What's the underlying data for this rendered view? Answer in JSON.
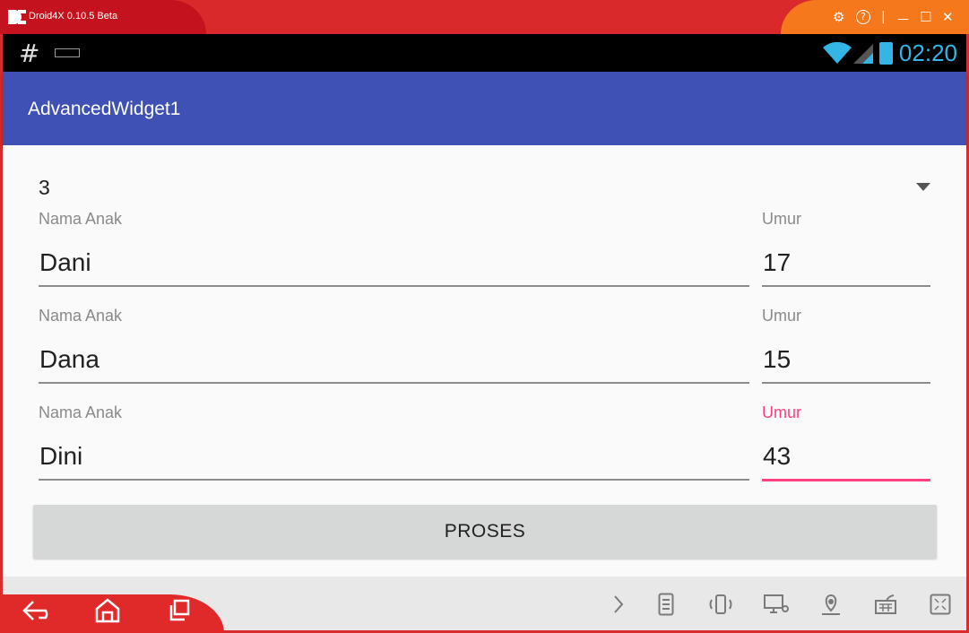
{
  "window": {
    "title": "Droid4X 0.10.5 Beta",
    "controls": {
      "settings": "⚙",
      "help": "?",
      "minimize": "—",
      "maximize": "☐",
      "close": "✕"
    }
  },
  "statusbar": {
    "left_icon": "#",
    "time": "02:20"
  },
  "appbar": {
    "title": "AdvancedWidget1"
  },
  "spinner": {
    "selected_value": "3"
  },
  "rows": [
    {
      "name_label": "Nama Anak",
      "name_value": "Dani",
      "age_label": "Umur",
      "age_value": "17"
    },
    {
      "name_label": "Nama Anak",
      "name_value": "Dana",
      "age_label": "Umur",
      "age_value": "15"
    },
    {
      "name_label": "Nama Anak",
      "name_value": "Dini",
      "age_label": "Umur",
      "age_value": "43"
    }
  ],
  "button": {
    "label": "PROSES"
  },
  "colors": {
    "primary": "#3f51b5",
    "accent": "#ff4081",
    "status_clock": "#33b5e5",
    "emulator_red": "#d9292b",
    "emulator_orange": "#f6781c"
  },
  "icons": {
    "nav": [
      "back-icon",
      "home-icon",
      "recents-icon"
    ],
    "tools": [
      "chevron-right-icon",
      "document-icon",
      "shake-icon",
      "screen-share-icon",
      "location-icon",
      "keyboard-icon",
      "fullscreen-icon"
    ]
  }
}
